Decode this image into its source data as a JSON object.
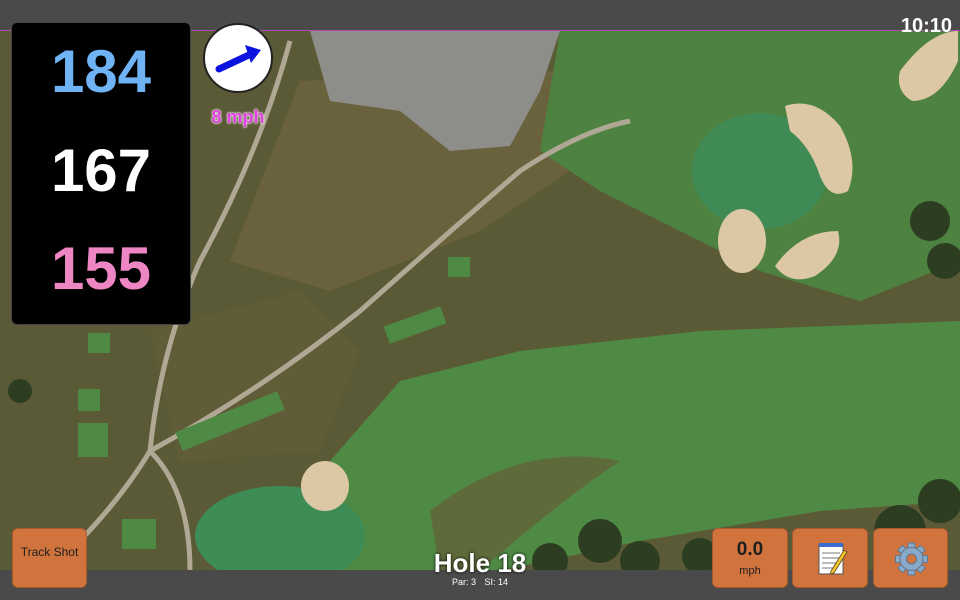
{
  "status": {
    "time": "10:10"
  },
  "distances": {
    "back": "184",
    "middle": "167",
    "front": "155",
    "colors": {
      "back": "#6fb3f5",
      "middle": "#ffffff",
      "front": "#ef86c4"
    }
  },
  "wind": {
    "speed_label": "8 mph",
    "icon": "wind-arrow-icon"
  },
  "hole": {
    "title": "Hole 18",
    "par": "Par: 3",
    "si": "SI: 14"
  },
  "buttons": {
    "track_shot": "Track Shot",
    "speed_value": "0.0",
    "speed_unit": "mph",
    "notes_icon": "notepad-icon",
    "settings_icon": "gear-icon"
  },
  "colors": {
    "button": "#d0733c",
    "fairway": "#4f8a45",
    "green": "#3f8a55",
    "rough": "#5a5a35",
    "bunker": "#dcc8a4",
    "path": "#b0a894"
  }
}
